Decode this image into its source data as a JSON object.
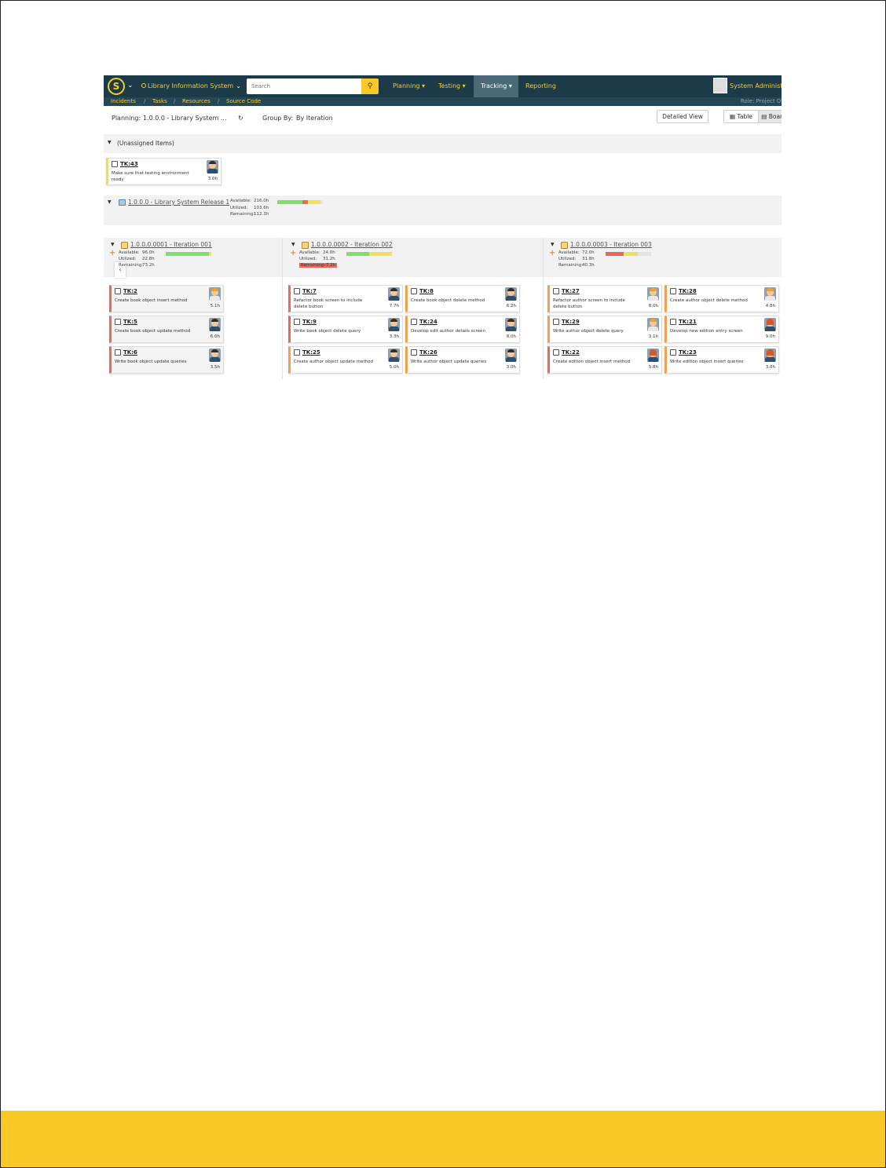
{
  "app": {
    "project": "Library Information System",
    "search_placeholder": "Search",
    "nav": [
      "Planning ▾",
      "Testing ▾",
      "Tracking ▾",
      "Reporting"
    ],
    "active_nav": "Tracking ▾",
    "user": "System Administrator",
    "role": "Role: Project Owner",
    "breadcrumbs": [
      "Incidents",
      "Tasks",
      "Resources",
      "Source Code"
    ]
  },
  "toolbar": {
    "planning_label": "Planning:",
    "planning_value": "1.0.0.0 - Library System ...",
    "group_by_label": "Group By:",
    "group_by_value": "By Iteration",
    "detailed_view": "Detailed View",
    "table_label": "Table",
    "board_label": "Board"
  },
  "unassigned": {
    "title": "(Unassigned Items)",
    "cards": [
      {
        "id": "TK:43",
        "name": "Make sure that testing environment ready",
        "est": "3.0h",
        "color": "yellow"
      }
    ]
  },
  "release": {
    "title": "1.0.0.0 - Library System Release 1",
    "available_label": "Available:",
    "available": "216.0h",
    "utilized_label": "Utilized:",
    "utilized": "103.6h",
    "remaining_label": "Remaining:",
    "remaining": "112.3h",
    "progress": {
      "green": 0.55,
      "red": 0.12,
      "yellow": 0.28
    }
  },
  "iterations": [
    {
      "title": "1.0.0.0.0001 - Iteration 001",
      "available": "96.0h",
      "utilized": "22.8h",
      "remaining": "73.2h",
      "remaining_warn": false,
      "progress": {
        "red": 0.0,
        "green": 0.95,
        "yellow": 0.05
      },
      "cards": [
        {
          "id": "TK:2",
          "name": "Create book object insert method",
          "est": "5.1h",
          "color": "red",
          "avatar": "o"
        },
        {
          "id": "TK:5",
          "name": "Create book object update method",
          "est": "6.0h",
          "color": "red",
          "avatar": "m"
        },
        {
          "id": "TK:6",
          "name": "Write book object update queries",
          "est": "3.5h",
          "color": "red",
          "avatar": "m"
        }
      ]
    },
    {
      "title": "1.0.0.0.0002 - Iteration 002",
      "available": "24.0h",
      "utilized": "31.2h",
      "remaining": "-7.2h",
      "remaining_warn": true,
      "progress": {
        "red": 0.0,
        "green": 0.5,
        "yellow": 0.5
      },
      "cards": [
        {
          "id": "TK:7",
          "name": "Refactor book screen to include delete button",
          "est": "7.7h",
          "color": "red",
          "avatar": "m"
        },
        {
          "id": "TK:8",
          "name": "Create book object delete method",
          "est": "6.2h",
          "color": "orange",
          "avatar": "m"
        },
        {
          "id": "TK:9",
          "name": "Write book object delete query",
          "est": "3.3h",
          "color": "red",
          "avatar": "m"
        },
        {
          "id": "TK:24",
          "name": "Develop edit author details screen",
          "est": "8.0h",
          "color": "orange",
          "avatar": "m"
        },
        {
          "id": "TK:25",
          "name": "Create author object update method",
          "est": "5.0h",
          "color": "orange",
          "avatar": "m"
        },
        {
          "id": "TK:26",
          "name": "Write author object update queries",
          "est": "3.0h",
          "color": "orange",
          "avatar": "m"
        }
      ]
    },
    {
      "title": "1.0.0.0.0003 - Iteration 003",
      "available": "72.0h",
      "utilized": "31.8h",
      "remaining": "40.3h",
      "remaining_warn": false,
      "progress": {
        "red": 0.4,
        "green": 0.0,
        "yellow": 0.3
      },
      "cards": [
        {
          "id": "TK:27",
          "name": "Refactor author screen to include delete button",
          "est": "8.0h",
          "color": "orange",
          "avatar": "o"
        },
        {
          "id": "TK:28",
          "name": "Create author object delete method",
          "est": "4.8h",
          "color": "orange",
          "avatar": "o"
        },
        {
          "id": "TK:29",
          "name": "Write author object delete query",
          "est": "3.1h",
          "color": "orange",
          "avatar": "o"
        },
        {
          "id": "TK:21",
          "name": "Develop new edition entry screen",
          "est": "9.0h",
          "color": "orange",
          "avatar": "f"
        },
        {
          "id": "TK:22",
          "name": "Create edition object insert method",
          "est": "5.8h",
          "color": "red",
          "avatar": "f"
        },
        {
          "id": "TK:23",
          "name": "Write edition object insert queries",
          "est": "3.0h",
          "color": "orange",
          "avatar": "f"
        }
      ]
    }
  ],
  "colors": {
    "nav_bg": "#1c3b49",
    "accent": "#fbc926",
    "red": "#e86a5a",
    "orange": "#f0a050",
    "yellow": "#f0e040",
    "green": "#7ee06a"
  }
}
